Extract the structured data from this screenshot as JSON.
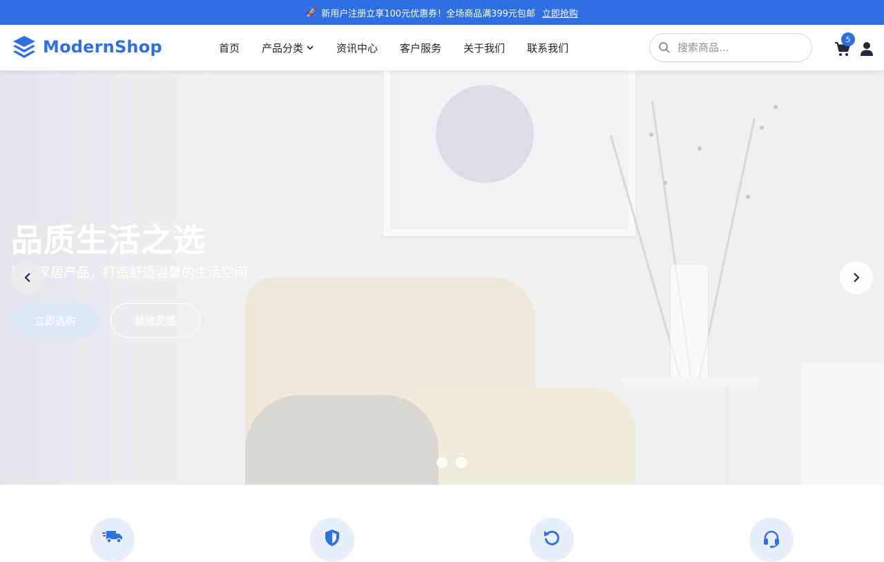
{
  "promo": {
    "icon": "rocket-icon",
    "text": "新用户注册立享100元优惠券！全场商品满399元包邮",
    "link": "立即抢购"
  },
  "header": {
    "brand": "ModernShop",
    "brand_color": "#2f6fe4",
    "nav": [
      {
        "label": "首页"
      },
      {
        "label": "产品分类",
        "has_dropdown": true
      },
      {
        "label": "资讯中心"
      },
      {
        "label": "客户服务"
      },
      {
        "label": "关于我们"
      },
      {
        "label": "联系我们"
      }
    ],
    "search_placeholder": "搜索商品...",
    "cart_count": "5"
  },
  "hero": {
    "title": "品质生活之选",
    "subtitle": "精选家居产品，打造舒适温馨的生活空间",
    "primary_button": "立即选购",
    "secondary_button": "装修灵感",
    "slides_total": 2,
    "active_slide": 1
  },
  "features": {
    "icons": [
      "truck-icon",
      "shield-icon",
      "return-icon",
      "headset-icon"
    ]
  }
}
